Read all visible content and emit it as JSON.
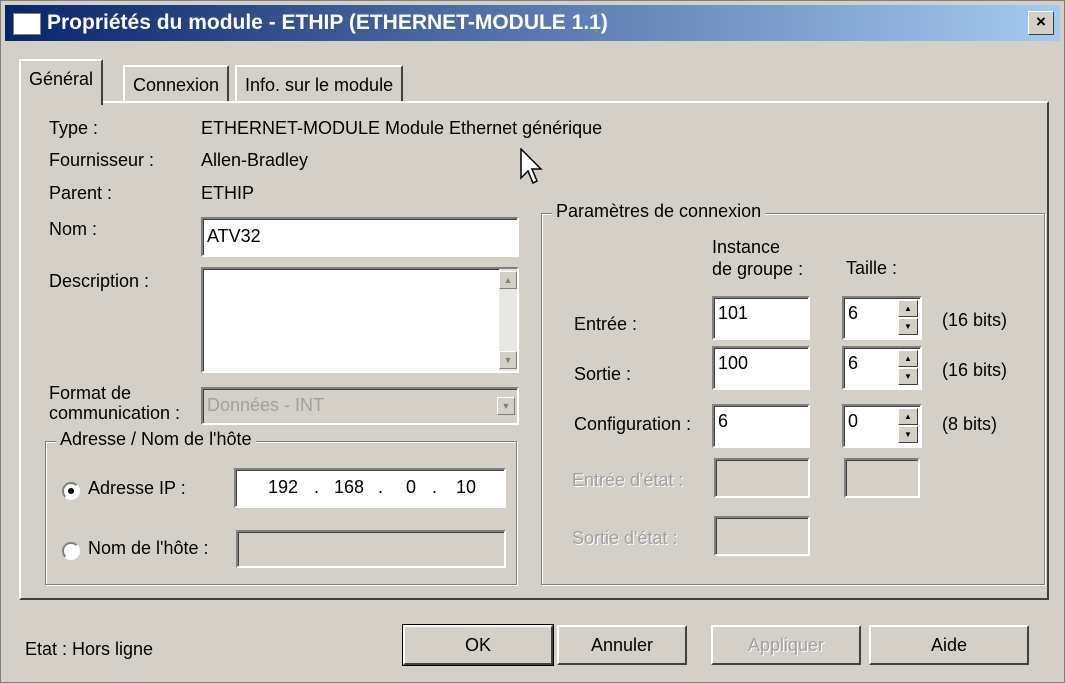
{
  "window": {
    "title": "Propriétés du module - ETHIP (ETHERNET-MODULE 1.1)",
    "close_label": "×"
  },
  "tabs": [
    {
      "label": "Général"
    },
    {
      "label": "Connexion"
    },
    {
      "label": "Info. sur le module"
    }
  ],
  "general": {
    "type_label": "Type :",
    "type_value": "ETHERNET-MODULE Module Ethernet générique",
    "vendor_label": "Fournisseur :",
    "vendor_value": "Allen-Bradley",
    "parent_label": "Parent :",
    "parent_value": "ETHIP",
    "name_label": "Nom :",
    "name_value": "ATV32",
    "description_label": "Description :",
    "description_value": "",
    "format_label_line1": "Format de",
    "format_label_line2": "communication :",
    "format_value": "Données - INT"
  },
  "address": {
    "group_title": "Adresse / Nom de l'hôte",
    "ip_label": "Adresse IP :",
    "ip_octets": [
      "192",
      "168",
      "0",
      "10"
    ],
    "ip_selected": true,
    "host_label": "Nom de l'hôte :",
    "host_value": ""
  },
  "connection": {
    "group_title": "Paramètres de connexion",
    "col_instance_line1": "Instance",
    "col_instance_line2": "de groupe :",
    "col_size": "Taille :",
    "rows": [
      {
        "label": "Entrée :",
        "instance": "101",
        "size": "6",
        "unit": "(16 bits)",
        "enabled": true
      },
      {
        "label": "Sortie :",
        "instance": "100",
        "size": "6",
        "unit": "(16 bits)",
        "enabled": true
      },
      {
        "label": "Configuration :",
        "instance": "6",
        "size": "0",
        "unit": "(8 bits)",
        "enabled": true
      },
      {
        "label": "Entrée d'état :",
        "instance": "",
        "size": "",
        "unit": "",
        "enabled": false
      },
      {
        "label": "Sortie d'état :",
        "instance": "",
        "size": "",
        "unit": "",
        "enabled": false
      }
    ]
  },
  "footer": {
    "status": "Etat : Hors ligne",
    "ok_label": "OK",
    "cancel_label": "Annuler",
    "apply_label": "Appliquer",
    "help_label": "Aide"
  },
  "icons": [
    "window-icon",
    "close-icon",
    "scroll-up-icon",
    "scroll-down-icon",
    "dropdown-arrow-icon",
    "spin-up-icon",
    "spin-down-icon",
    "mouse-cursor-icon"
  ]
}
